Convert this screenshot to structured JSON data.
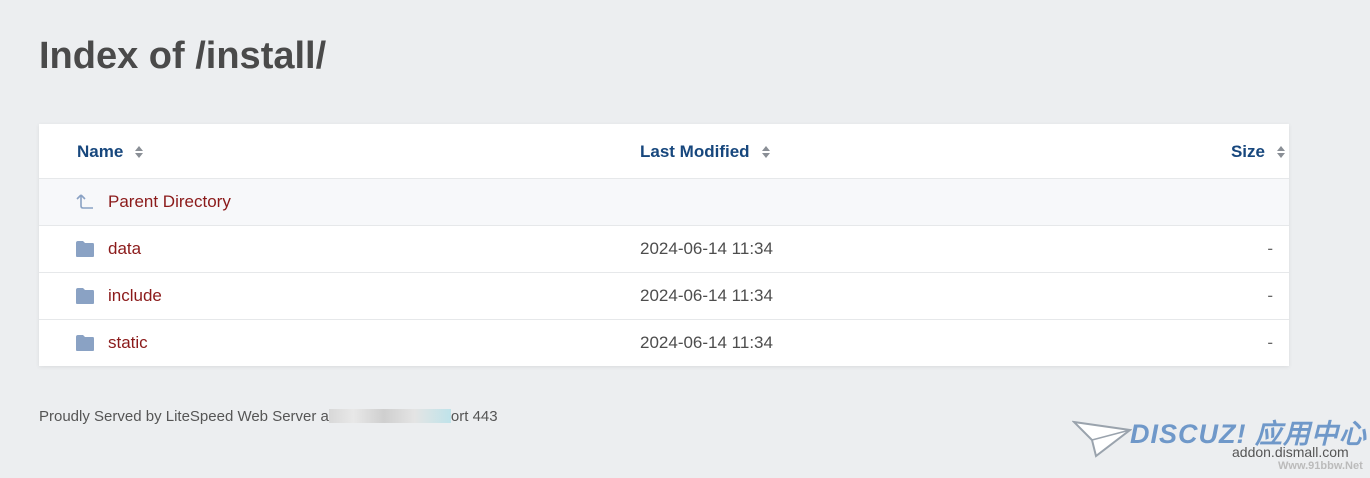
{
  "page": {
    "title": "Index of /install/"
  },
  "table": {
    "headers": {
      "name": "Name",
      "modified": "Last Modified",
      "size": "Size"
    },
    "parent": {
      "label": "Parent Directory"
    },
    "rows": [
      {
        "name": "data",
        "modified": "2024-06-14 11:34",
        "size": "-"
      },
      {
        "name": "include",
        "modified": "2024-06-14 11:34",
        "size": "-"
      },
      {
        "name": "static",
        "modified": "2024-06-14 11:34",
        "size": "-"
      }
    ]
  },
  "footer": {
    "prefix": "Proudly Served by LiteSpeed Web Server a",
    "suffix": "ort 443"
  },
  "watermark": {
    "brand": "DISCUZ! 应用中心",
    "url": "addon.dismall.com",
    "site": "Www.91bbw.Net"
  },
  "colors": {
    "link": "#8b1a1a",
    "header": "#17477d",
    "folder": "#8aa2c4",
    "background": "#eceef0"
  }
}
